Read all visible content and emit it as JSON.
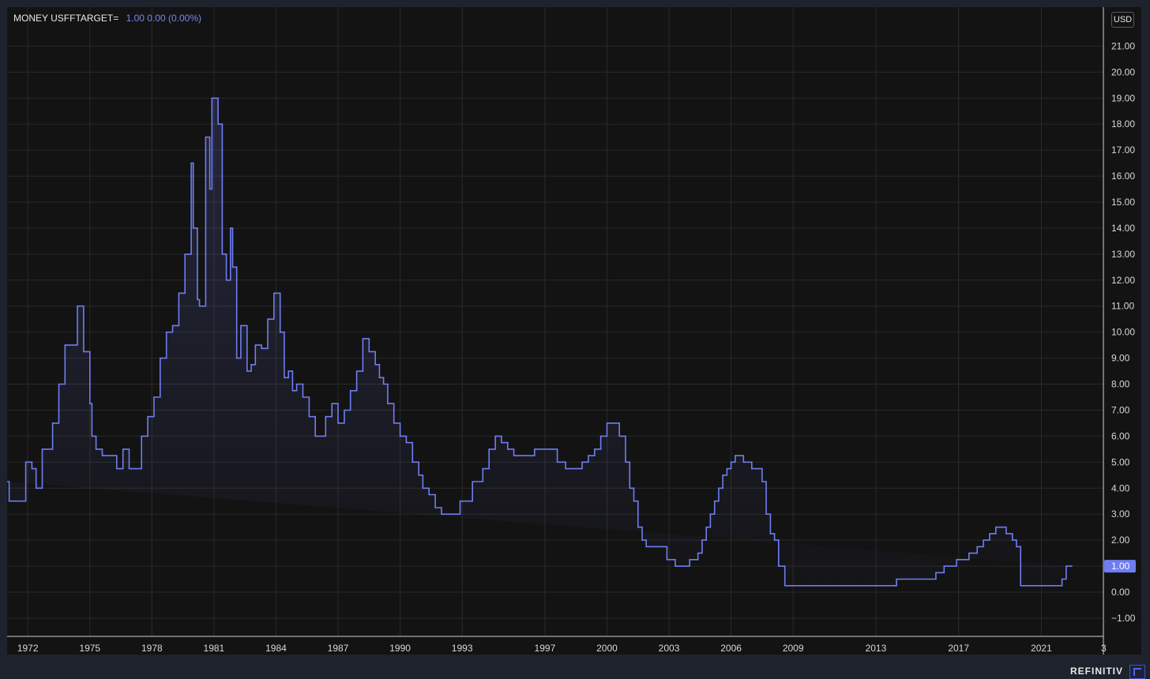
{
  "legend": {
    "symbol": "MONEY USFFTARGET=",
    "value": "1.00  0.00 (0.00%)"
  },
  "currency_badge": "USD",
  "last_value_label": "1.00",
  "brand": "REFINITIV",
  "colors": {
    "background": "#131313",
    "frame": "#1e222d",
    "line": "#6f7df2",
    "grid": "#2a2a2a",
    "badge": "#6f7df2"
  },
  "chart_data": {
    "type": "area",
    "step": true,
    "ylim": [
      -1.7,
      22.5
    ],
    "y_ticks": [
      -1,
      0,
      1,
      2,
      3,
      4,
      5,
      6,
      7,
      8,
      9,
      10,
      11,
      12,
      13,
      14,
      15,
      16,
      17,
      18,
      19,
      20,
      21
    ],
    "y_tick_labels": [
      "−1.00",
      "0.00",
      "1.00",
      "2.00",
      "3.00",
      "4.00",
      "5.00",
      "6.00",
      "7.00",
      "8.00",
      "9.00",
      "10.00",
      "11.00",
      "12.00",
      "13.00",
      "14.00",
      "15.00",
      "16.00",
      "17.00",
      "18.00",
      "19.00",
      "20.00",
      "21.00"
    ],
    "xlim": [
      1971.0,
      2024.0
    ],
    "x_ticks": [
      1972,
      1975,
      1978,
      1981,
      1984,
      1987,
      1990,
      1993,
      1997,
      2000,
      2003,
      2006,
      2009,
      2013,
      2017,
      2021,
      2024.05
    ],
    "x_tick_labels": [
      "1972",
      "1975",
      "1978",
      "1981",
      "1984",
      "1987",
      "1990",
      "1993",
      "1997",
      "2000",
      "2003",
      "2006",
      "2009",
      "2013",
      "2017",
      "2021",
      "3"
    ],
    "x": [
      1971.0,
      1971.1,
      1971.5,
      1971.9,
      1972.2,
      1972.4,
      1972.7,
      1973.0,
      1973.2,
      1973.5,
      1973.8,
      1974.2,
      1974.4,
      1974.7,
      1975.0,
      1975.1,
      1975.3,
      1975.6,
      1976.0,
      1976.3,
      1976.6,
      1976.9,
      1977.2,
      1977.5,
      1977.8,
      1978.1,
      1978.4,
      1978.7,
      1979.0,
      1979.3,
      1979.6,
      1979.9,
      1980.0,
      1980.2,
      1980.3,
      1980.6,
      1980.8,
      1980.9,
      1981.2,
      1981.4,
      1981.6,
      1981.8,
      1981.9,
      1982.1,
      1982.3,
      1982.6,
      1982.8,
      1983.0,
      1983.3,
      1983.6,
      1983.9,
      1984.2,
      1984.4,
      1984.6,
      1984.8,
      1985.0,
      1985.3,
      1985.6,
      1985.9,
      1986.1,
      1986.4,
      1986.7,
      1987.0,
      1987.3,
      1987.6,
      1987.9,
      1988.2,
      1988.5,
      1988.8,
      1989.0,
      1989.2,
      1989.4,
      1989.7,
      1990.0,
      1990.3,
      1990.6,
      1990.9,
      1991.1,
      1991.4,
      1991.7,
      1992.0,
      1992.3,
      1992.6,
      1992.9,
      1993.5,
      1994.0,
      1994.3,
      1994.6,
      1994.9,
      1995.2,
      1995.5,
      1995.8,
      1996.1,
      1996.5,
      1997.0,
      1997.3,
      1997.6,
      1998.0,
      1998.5,
      1998.8,
      1999.1,
      1999.4,
      1999.7,
      2000.0,
      2000.3,
      2000.6,
      2000.9,
      2001.1,
      2001.3,
      2001.5,
      2001.7,
      2001.9,
      2002.2,
      2002.6,
      2002.9,
      2003.3,
      2003.6,
      2004.0,
      2004.4,
      2004.6,
      2004.8,
      2005.0,
      2005.2,
      2005.4,
      2005.6,
      2005.8,
      2006.0,
      2006.2,
      2006.4,
      2006.6,
      2007.0,
      2007.5,
      2007.7,
      2007.9,
      2008.1,
      2008.3,
      2008.6,
      2008.9,
      2009.2,
      2010.0,
      2011.0,
      2012.0,
      2013.0,
      2014.0,
      2015.0,
      2015.9,
      2016.3,
      2016.9,
      2017.2,
      2017.5,
      2017.9,
      2018.2,
      2018.5,
      2018.8,
      2019.0,
      2019.3,
      2019.6,
      2019.8,
      2020.0,
      2020.2,
      2020.5,
      2021.0,
      2021.5,
      2022.0,
      2022.2,
      2022.4,
      2022.5
    ],
    "y": [
      4.25,
      3.5,
      3.5,
      5.0,
      4.75,
      4.0,
      5.5,
      5.5,
      6.5,
      8.0,
      9.5,
      9.5,
      11.0,
      9.25,
      7.25,
      6.0,
      5.5,
      5.25,
      5.25,
      4.75,
      5.5,
      4.75,
      4.75,
      6.0,
      6.75,
      7.5,
      9.0,
      10.0,
      10.25,
      11.5,
      13.0,
      16.5,
      14.0,
      11.25,
      11.0,
      17.5,
      15.5,
      19.0,
      18.0,
      13.0,
      12.0,
      14.0,
      12.5,
      9.0,
      10.25,
      8.5,
      8.75,
      9.5,
      9.375,
      10.5,
      11.5,
      10.0,
      8.25,
      8.5,
      7.75,
      8.0,
      7.5,
      6.75,
      6.0,
      6.0,
      6.75,
      7.25,
      6.5,
      7.0,
      7.75,
      8.5,
      9.75,
      9.25,
      8.75,
      8.25,
      8.0,
      7.25,
      6.5,
      6.0,
      5.75,
      5.0,
      4.5,
      4.0,
      3.75,
      3.25,
      3.0,
      3.0,
      3.0,
      3.5,
      4.25,
      4.75,
      5.5,
      6.0,
      5.75,
      5.5,
      5.25,
      5.25,
      5.25,
      5.5,
      5.5,
      5.5,
      5.0,
      4.75,
      4.75,
      5.0,
      5.25,
      5.5,
      6.0,
      6.5,
      6.5,
      6.0,
      5.0,
      4.0,
      3.5,
      2.5,
      2.0,
      1.75,
      1.75,
      1.75,
      1.25,
      1.0,
      1.0,
      1.25,
      1.5,
      2.0,
      2.5,
      3.0,
      3.5,
      4.0,
      4.5,
      4.75,
      5.0,
      5.25,
      5.25,
      5.0,
      4.75,
      4.25,
      3.0,
      2.25,
      2.0,
      1.0,
      0.25,
      0.25,
      0.25,
      0.25,
      0.25,
      0.25,
      0.25,
      0.5,
      0.5,
      0.75,
      1.0,
      1.25,
      1.25,
      1.5,
      1.75,
      2.0,
      2.25,
      2.5,
      2.5,
      2.25,
      2.0,
      1.75,
      0.25,
      0.25,
      0.25,
      0.25,
      0.25,
      0.5,
      1.0,
      1.0
    ]
  }
}
